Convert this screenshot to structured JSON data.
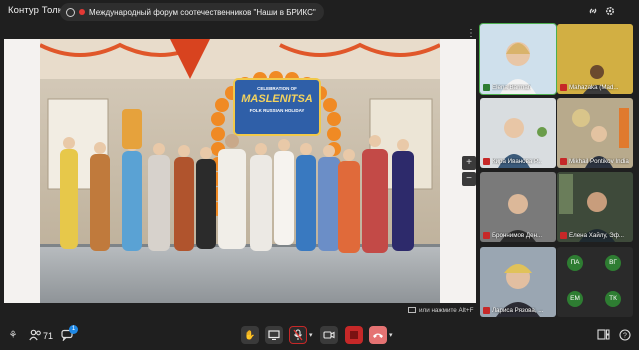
{
  "app": {
    "brand": "Контур Толк",
    "meeting_title": "Международный форум соотечественников \"Наши в БРИКС\""
  },
  "stage": {
    "banner_line1": "CELEBRATION OF",
    "banner_line2": "MASLENITSA",
    "banner_line3": "FOLK RUSSIAN HOLIDAY",
    "hint": "или нажмите Alt+F"
  },
  "participants": [
    {
      "name": "Elena Barman",
      "mic": "on",
      "active": true,
      "bg": "#5b7f9a"
    },
    {
      "name": "Mahazaka (Mad...",
      "mic": "off",
      "active": false,
      "bg": "#c9a43a"
    },
    {
      "name": "Кира Иванова Р...",
      "mic": "off",
      "active": false,
      "bg": "#d9dde0"
    },
    {
      "name": "Mikhail Pontikov India",
      "mic": "off",
      "active": false,
      "bg": "#b8aa8c"
    },
    {
      "name": "Броннимов Ден...",
      "mic": "off",
      "active": false,
      "bg": "#6c6c6c"
    },
    {
      "name": "Елена Хайлу, Эф...",
      "mic": "off",
      "active": false,
      "bg": "#3e4a3a"
    },
    {
      "name": "Лариса Рязова, ...",
      "mic": "off",
      "active": false,
      "bg": "#9aa6b2"
    }
  ],
  "avatars": [
    {
      "initials": "ПА",
      "color": "#2e7d32"
    },
    {
      "initials": "ВГ",
      "color": "#2e7d32"
    },
    {
      "initials": "ЕМ",
      "color": "#2e7d32"
    },
    {
      "initials": "ТК",
      "color": "#2e7d32"
    }
  ],
  "more_count": "+",
  "toolbar": {
    "participants_count": "71",
    "chat_badge": "1"
  },
  "icons": [
    "link-icon",
    "gear-icon",
    "hand-icon",
    "screen-share-icon",
    "mic-off-icon",
    "camera-off-icon",
    "record-icon",
    "hangup-icon",
    "layout-icon",
    "help-icon"
  ]
}
